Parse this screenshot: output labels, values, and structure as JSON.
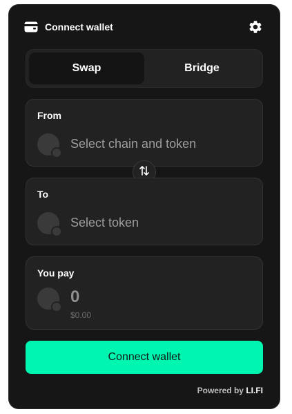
{
  "header": {
    "title": "Connect wallet",
    "wallet_icon": "wallet-icon",
    "settings_icon": "gear-icon"
  },
  "tabs": [
    {
      "label": "Swap",
      "active": true
    },
    {
      "label": "Bridge",
      "active": false
    }
  ],
  "from": {
    "label": "From",
    "placeholder": "Select chain and token"
  },
  "swap_direction_icon": "swap-arrows-icon",
  "to": {
    "label": "To",
    "placeholder": "Select token"
  },
  "you_pay": {
    "label": "You pay",
    "amount": "0",
    "fiat": "$0.00"
  },
  "connect_button": {
    "label": "Connect wallet"
  },
  "footer": {
    "powered_by": "Powered by",
    "brand": "LI.FI"
  },
  "colors": {
    "background": "#161616",
    "card": "#222222",
    "accent": "#00f5b0"
  }
}
